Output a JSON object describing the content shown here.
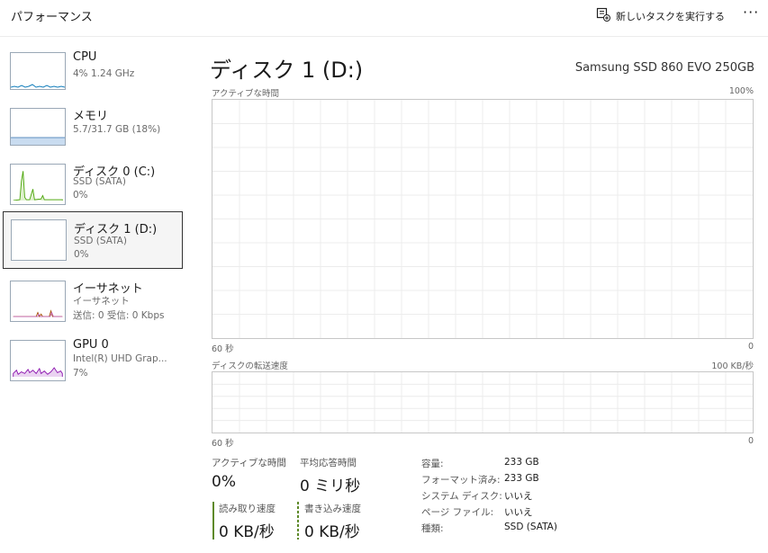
{
  "header": {
    "title": "パフォーマンス",
    "new_task_label": "新しいタスクを実行する",
    "more_label": "···"
  },
  "sidebar": {
    "items": [
      {
        "name": "CPU",
        "sub1": "4%  1.24 GHz",
        "sub2": "",
        "sub3": ""
      },
      {
        "name": "メモリ",
        "sub1": "5.7/31.7 GB (18%)",
        "sub2": "",
        "sub3": ""
      },
      {
        "name": "ディスク 0 (C:)",
        "sub1": "SSD (SATA)",
        "sub2": "0%",
        "sub3": ""
      },
      {
        "name": "ディスク 1 (D:)",
        "sub1": "SSD (SATA)",
        "sub2": "0%",
        "sub3": ""
      },
      {
        "name": "イーサネット",
        "sub1": "イーサネット",
        "sub2": "送信: 0 受信: 0 Kbps",
        "sub3": ""
      },
      {
        "name": "GPU 0",
        "sub1": "Intel(R) UHD Grap...",
        "sub2": "7%",
        "sub3": ""
      }
    ]
  },
  "main": {
    "disk_title": "ディスク 1 (D:)",
    "model": "Samsung SSD 860 EVO 250GB",
    "chart1": {
      "label": "アクティブな時間",
      "max": "100%",
      "time": "60 秒",
      "min": "0"
    },
    "chart2": {
      "label": "ディスクの転送速度",
      "max": "100 KB/秒",
      "time": "60 秒",
      "min": "0"
    },
    "stats": {
      "active_label": "アクティブな時間",
      "active_value": "0%",
      "resp_label": "平均応答時間",
      "resp_value": "0 ミリ秒",
      "read_label": "読み取り速度",
      "read_value": "0 KB/秒",
      "write_label": "書き込み速度",
      "write_value": "0 KB/秒"
    },
    "properties": [
      {
        "key": "容量:",
        "value": "233 GB"
      },
      {
        "key": "フォーマット済み:",
        "value": "233 GB"
      },
      {
        "key": "システム ディスク:",
        "value": "いいえ"
      },
      {
        "key": "ページ ファイル:",
        "value": "いいえ"
      },
      {
        "key": "種類:",
        "value": "SSD (SATA)"
      }
    ]
  },
  "colors": {
    "cpu": "#117dbb",
    "memory": "#8b12ae",
    "disk": "#4da60c",
    "ethernet": "#a74f01",
    "gpu": "#8b12ae",
    "selected_border": "#333333"
  }
}
